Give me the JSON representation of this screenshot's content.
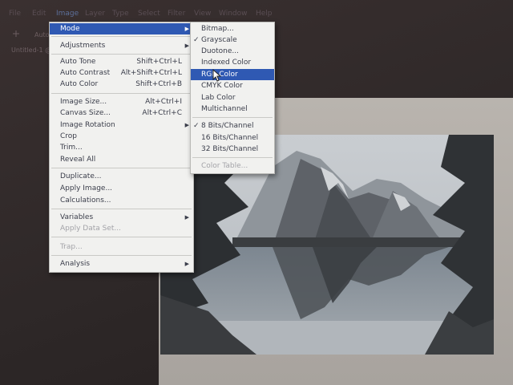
{
  "menubar": {
    "items": [
      "File",
      "Edit",
      "Image",
      "Layer",
      "Type",
      "Select",
      "Filter",
      "View",
      "Window",
      "Help"
    ]
  },
  "options": {
    "auto_label": "Auto"
  },
  "document": {
    "tab_label": "Untitled-1 @"
  },
  "image_menu": {
    "mode": "Mode",
    "adjustments": "Adjustments",
    "auto_tone": "Auto Tone",
    "auto_tone_sc": "Shift+Ctrl+L",
    "auto_contrast": "Auto Contrast",
    "auto_contrast_sc": "Alt+Shift+Ctrl+L",
    "auto_color": "Auto Color",
    "auto_color_sc": "Shift+Ctrl+B",
    "image_size": "Image Size...",
    "image_size_sc": "Alt+Ctrl+I",
    "canvas_size": "Canvas Size...",
    "canvas_size_sc": "Alt+Ctrl+C",
    "image_rotation": "Image Rotation",
    "crop": "Crop",
    "trim": "Trim...",
    "reveal_all": "Reveal All",
    "duplicate": "Duplicate...",
    "apply_image": "Apply Image...",
    "calculations": "Calculations...",
    "variables": "Variables",
    "apply_data_set": "Apply Data Set...",
    "trap": "Trap...",
    "analysis": "Analysis"
  },
  "mode_menu": {
    "bitmap": "Bitmap...",
    "grayscale": "Grayscale",
    "duotone": "Duotone...",
    "indexed_color": "Indexed Color",
    "rgb_color": "RGB Color",
    "cmyk_color": "CMYK Color",
    "lab_color": "Lab Color",
    "multichannel": "Multichannel",
    "bits8": "8 Bits/Channel",
    "bits16": "16 Bits/Channel",
    "bits32": "32 Bits/Channel",
    "color_table": "Color Table..."
  },
  "colors": {
    "highlight": "#2f59b3",
    "menu_bg": "#f1f1ef",
    "disabled_text": "#a3a3a8"
  },
  "icons": {
    "check": "checkmark-icon",
    "submenu": "submenu-arrow-icon",
    "cursor": "mouse-pointer-icon"
  }
}
